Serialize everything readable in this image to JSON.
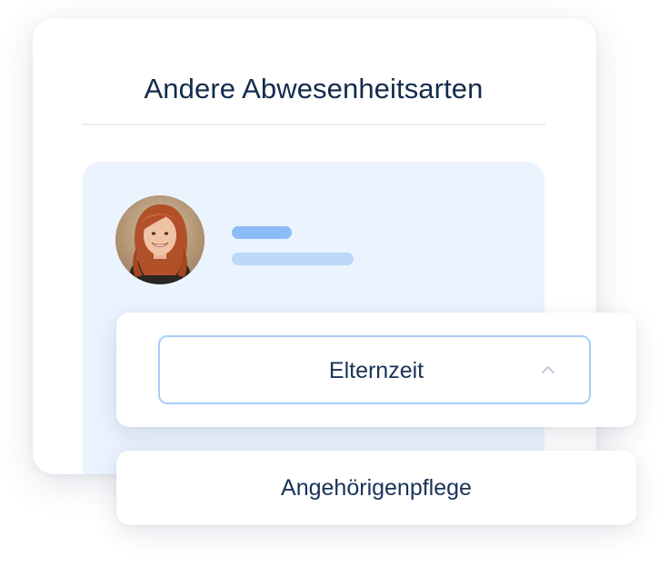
{
  "card": {
    "title": "Andere Abwesenheitsarten"
  },
  "employee": {
    "avatar": "avatar-photo-woman-red-hair"
  },
  "absence_type_select": {
    "selected_value": "Elternzeit",
    "icon": "chevron-up-icon",
    "expanded": true,
    "options": [
      {
        "label": "Angehörigenpflege"
      }
    ]
  },
  "colors": {
    "title_text": "#132b4d",
    "panel_background": "#eaf3fe",
    "skeleton_primary": "#8cbcf6",
    "skeleton_secondary": "#bcd8fb",
    "select_border": "#a9cdf8",
    "option_text": "#1a3358"
  }
}
